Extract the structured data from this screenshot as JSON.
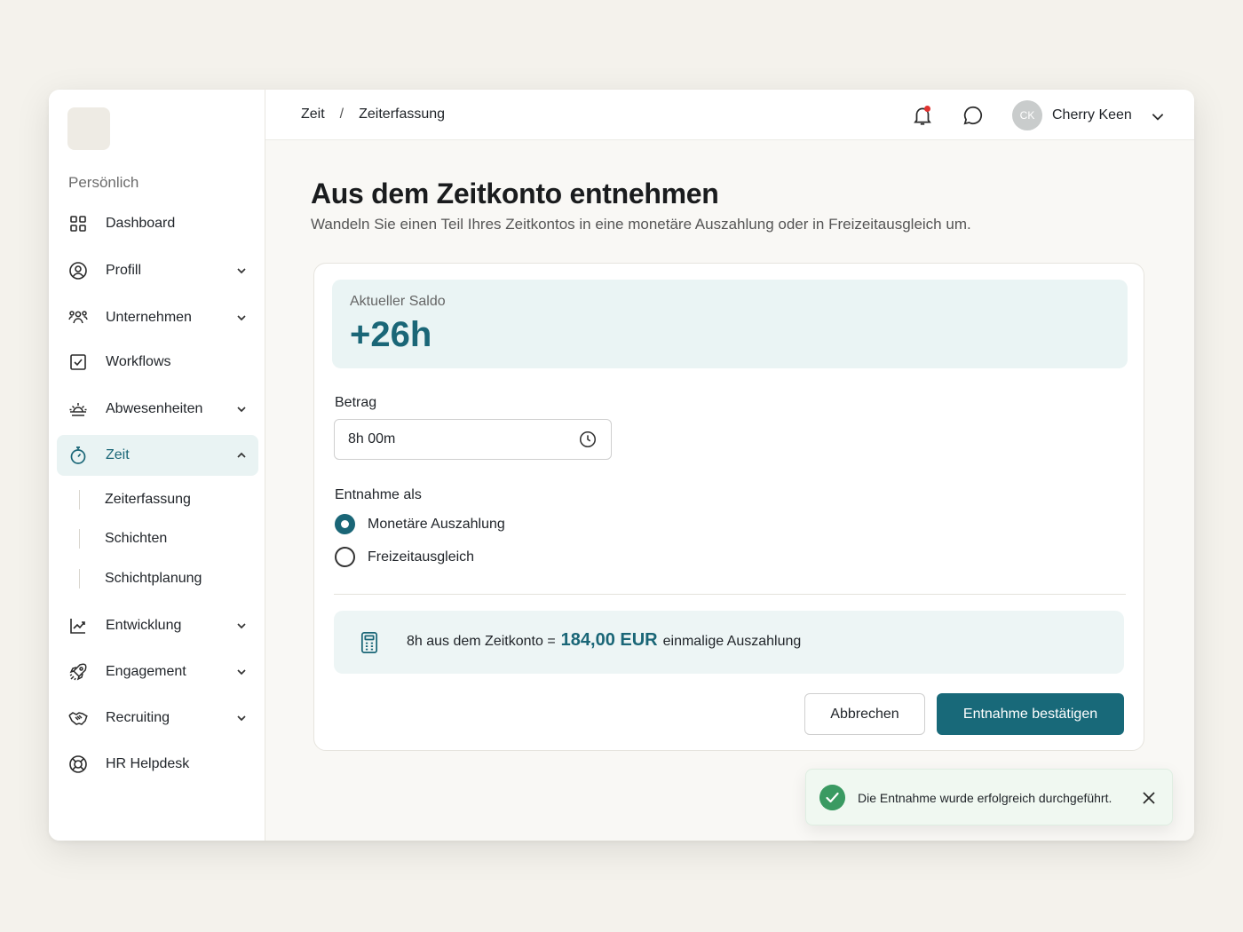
{
  "sidebar": {
    "section_label": "Persönlich",
    "items": [
      {
        "label": "Dashboard",
        "icon": "dashboard-icon"
      },
      {
        "label": "Profill",
        "icon": "user-circle-icon"
      },
      {
        "label": "Unternehmen",
        "icon": "team-icon"
      },
      {
        "label": "Workflows",
        "icon": "checkbox-icon"
      },
      {
        "label": "Abwesenheiten",
        "icon": "sunset-icon"
      },
      {
        "label": "Zeit",
        "icon": "stopwatch-icon"
      },
      {
        "label": "Entwicklung",
        "icon": "chart-line-icon"
      },
      {
        "label": "Engagement",
        "icon": "rocket-icon"
      },
      {
        "label": "Recruiting",
        "icon": "handshake-icon"
      },
      {
        "label": "HR Helpdesk",
        "icon": "lifebuoy-icon"
      }
    ],
    "sub_items": [
      {
        "label": "Zeiterfassung"
      },
      {
        "label": "Schichten"
      },
      {
        "label": "Schichtplanung"
      }
    ]
  },
  "header": {
    "breadcrumb": [
      "Zeit",
      "Zeiterfassung"
    ],
    "breadcrumb_sep": "/",
    "user": {
      "initials": "CK",
      "name": "Cherry Keen"
    }
  },
  "main": {
    "title": "Aus dem Zeitkonto entnehmen",
    "subtitle": "Wandeln Sie einen Teil Ihres Zeitkontos in eine monetäre Auszahlung oder in Freizeitausgleich um.",
    "saldo": {
      "label": "Aktueller Saldo",
      "value": "+26h"
    },
    "amount": {
      "label": "Betrag",
      "value": "8h 00m"
    },
    "withdraw_as": {
      "label": "Entnahme als",
      "options": [
        {
          "label": "Monetäre Auszahlung",
          "selected": true
        },
        {
          "label": "Freizeitausgleich",
          "selected": false
        }
      ]
    },
    "calculation": {
      "prefix": "8h aus dem Zeitkonto =",
      "amount": "184,00 EUR",
      "suffix": "einmalige Auszahlung"
    },
    "buttons": {
      "cancel": "Abbrechen",
      "confirm": "Entnahme bestätigen"
    }
  },
  "toast": {
    "message": "Die Entnahme wurde erfolgreich durchgeführt."
  },
  "colors": {
    "accent": "#1a6677",
    "background": "#f4f2ec",
    "success": "#3a9a62",
    "notification": "#e0322f"
  }
}
